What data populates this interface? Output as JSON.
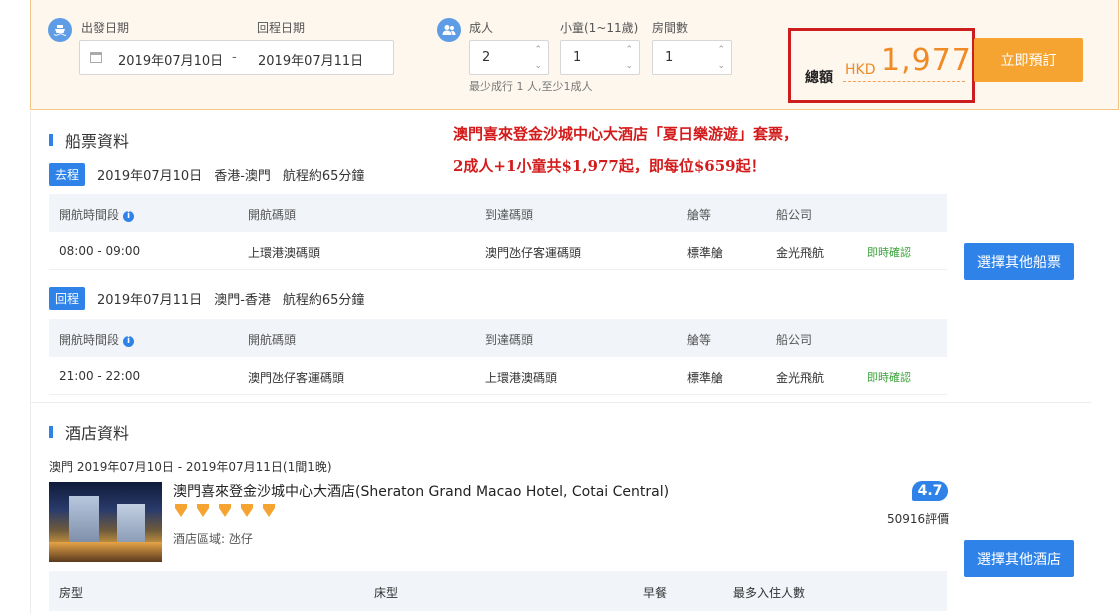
{
  "booking_bar": {
    "depart_label": "出發日期",
    "return_label": "回程日期",
    "depart_date": "2019年07月10日",
    "date_separator": "-",
    "return_date": "2019年07月11日",
    "adult_label": "成人",
    "child_label": "小童(1~11歲)",
    "room_label": "房間數",
    "adults": "2",
    "children": "1",
    "rooms": "1",
    "hint": "最少成行 1 人,至少1成人",
    "total_label": "總額",
    "currency": "HKD",
    "total_amount": "1,977",
    "book_button": "立即預訂"
  },
  "promo": {
    "line1": "澳門喜來登金沙城中心大酒店「夏日樂游遊」套票，",
    "line2": "2成人+1小童共$1,977起，即每位$659起！"
  },
  "ferry": {
    "section_title": "船票資料",
    "change_button": "選擇其他船票",
    "columns": [
      "開航時間段",
      "開航碼頭",
      "到達碼頭",
      "艙等",
      "船公司"
    ],
    "trips": [
      {
        "tag": "去程",
        "date": "2019年07月10日",
        "route": "香港-澳門",
        "duration": "航程約65分鐘",
        "time": "08:00 - 09:00",
        "from": "上環港澳碼頭",
        "to": "澳門氹仔客運碼頭",
        "class": "標準艙",
        "company": "金光飛航",
        "status": "即時確認"
      },
      {
        "tag": "回程",
        "date": "2019年07月11日",
        "route": "澳門-香港",
        "duration": "航程約65分鐘",
        "time": "21:00 - 22:00",
        "from": "澳門氹仔客運碼頭",
        "to": "上環港澳碼頭",
        "class": "標準艙",
        "company": "金光飛航",
        "status": "即時確認"
      }
    ]
  },
  "hotel": {
    "section_title": "酒店資料",
    "stay": "澳門 2019年07月10日 - 2019年07月11日(1間1晚)",
    "name": "澳門喜來登金沙城中心大酒店(Sheraton Grand Macao Hotel, Cotai Central)",
    "star_count": 5,
    "area": "酒店區域: 氹仔",
    "rating": "4.7",
    "reviews": "50916評價",
    "change_button": "選擇其他酒店",
    "room_columns": [
      "房型",
      "床型",
      "早餐",
      "最多入住人數"
    ]
  },
  "colors": {
    "accent_blue": "#2f83e8",
    "accent_orange": "#f5a431",
    "promo_red": "#d31b1b",
    "confirm_green": "#3aa33a"
  }
}
